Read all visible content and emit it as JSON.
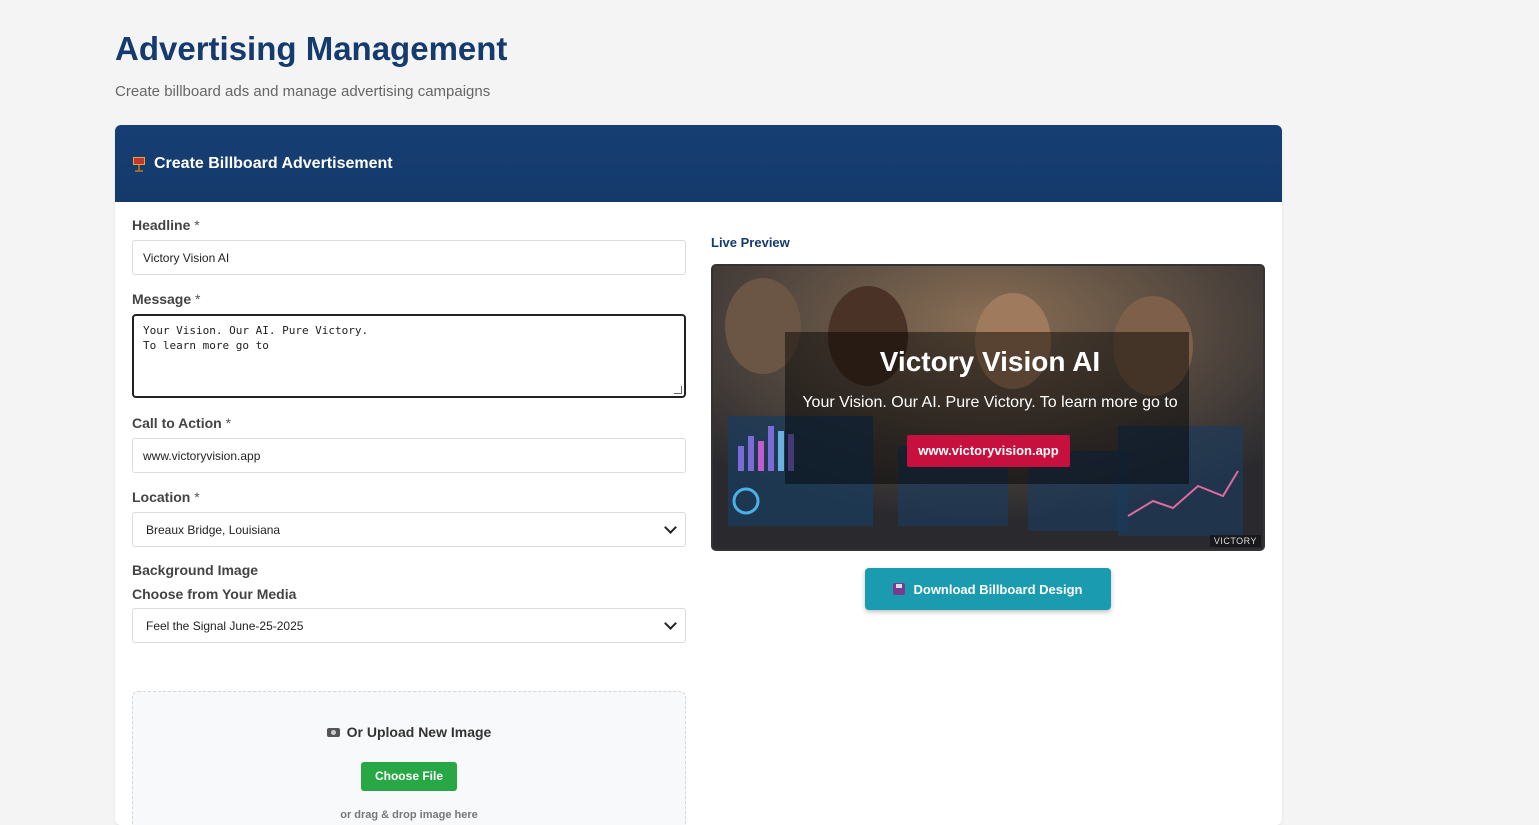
{
  "page": {
    "title": "Advertising Management",
    "subtitle": "Create billboard ads and manage advertising campaigns"
  },
  "card": {
    "title": "Create Billboard Advertisement",
    "icon": "billboard-icon"
  },
  "form": {
    "headline": {
      "label": "Headline",
      "required": "*",
      "value": "Victory Vision AI"
    },
    "message": {
      "label": "Message",
      "required": "*",
      "value": "Your Vision. Our AI. Pure Victory.\nTo learn more go to"
    },
    "cta": {
      "label": "Call to Action",
      "required": "*",
      "value": "www.victoryvision.app"
    },
    "location": {
      "label": "Location",
      "required": "*",
      "value": "Breaux Bridge, Louisiana"
    },
    "background": {
      "label": "Background Image",
      "media_label": "Choose from Your Media",
      "media_value": "Feel the Signal June-25-2025"
    },
    "upload": {
      "title": "Or Upload New Image",
      "button": "Choose File",
      "hint": "or drag & drop image here"
    }
  },
  "preview": {
    "label": "Live Preview",
    "headline": "Victory Vision AI",
    "message": "Your Vision. Our AI. Pure Victory. To learn more go to",
    "cta": "www.victoryvision.app",
    "watermark": "VICTORY",
    "download_button": "Download Billboard Design"
  },
  "colors": {
    "title": "#153a6e",
    "header_bg": "#173e74",
    "cta_red": "#c8103e",
    "upload_green": "#28a745",
    "download_teal": "#1a9bb0"
  }
}
